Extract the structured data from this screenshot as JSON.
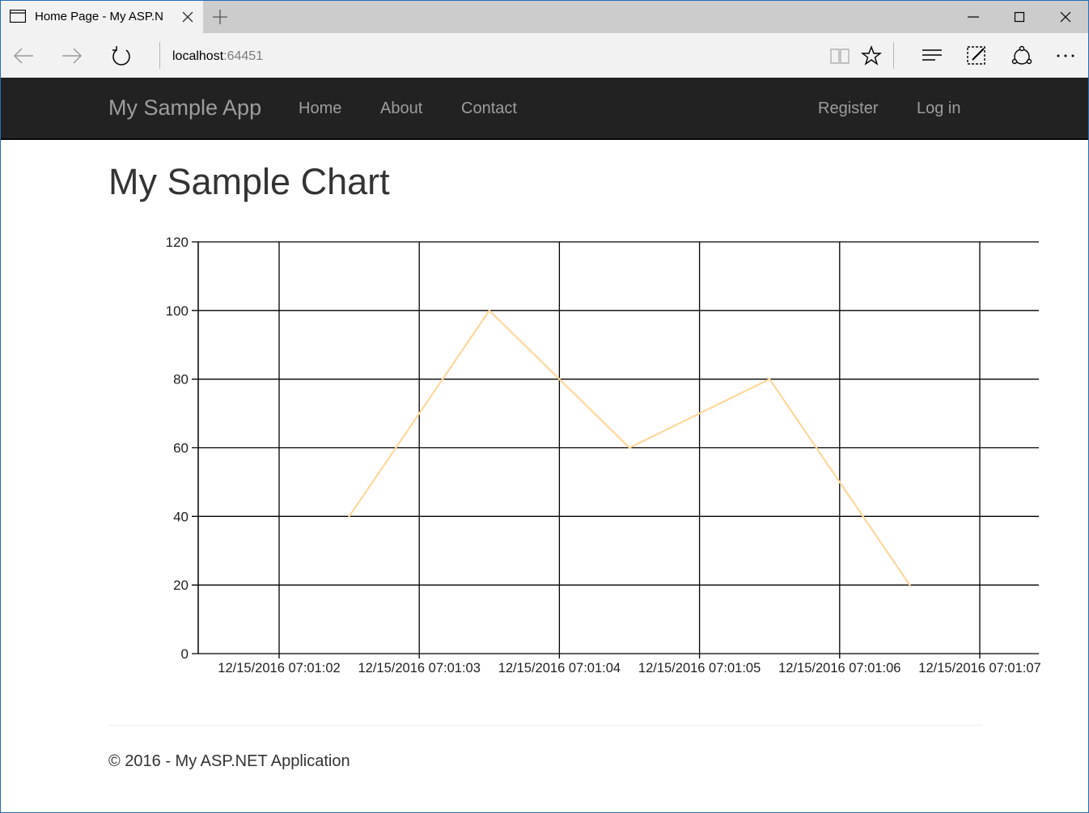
{
  "browser": {
    "tab_title": "Home Page - My ASP.N",
    "url_host": "localhost",
    "url_port": ":64451",
    "icons": {
      "tab": "page-icon",
      "close_tab": "close-icon",
      "new_tab": "plus-icon",
      "minimize": "minimize-icon",
      "maximize": "maximize-icon",
      "close_window": "close-icon",
      "back": "back-arrow-icon",
      "forward": "forward-arrow-icon",
      "refresh": "refresh-icon",
      "reading_view": "book-icon",
      "favorite": "star-icon",
      "hub": "hub-icon",
      "web_note": "pen-note-icon",
      "share": "share-icon",
      "more": "ellipsis-icon"
    }
  },
  "navbar": {
    "brand": "My Sample App",
    "links": [
      "Home",
      "About",
      "Contact"
    ],
    "right_links": [
      "Register",
      "Log in"
    ],
    "background": "#222222",
    "link_color": "#9d9d9d"
  },
  "main": {
    "title": "My Sample Chart"
  },
  "chart_data": {
    "type": "line",
    "title": "",
    "xlabel": "",
    "ylabel": "",
    "categories": [
      "12/15/2016 07:01:02",
      "12/15/2016 07:01:03",
      "12/15/2016 07:01:04",
      "12/15/2016 07:01:05",
      "12/15/2016 07:01:06",
      "12/15/2016 07:01:07"
    ],
    "series": [
      {
        "x": [
          "12/15/2016 07:01:02.5",
          "12/15/2016 07:01:03.5",
          "12/15/2016 07:01:04.5",
          "12/15/2016 07:01:05.5",
          "12/15/2016 07:01:06.5"
        ],
        "values": [
          40,
          100,
          60,
          80,
          20
        ],
        "color": "#ffd89a"
      }
    ],
    "yticks": [
      "0",
      "20",
      "40",
      "60",
      "80",
      "100",
      "120"
    ],
    "ylim": [
      0,
      120
    ],
    "grid": true,
    "grid_color": "#000000"
  },
  "footer": {
    "text": "© 2016 - My ASP.NET Application"
  }
}
